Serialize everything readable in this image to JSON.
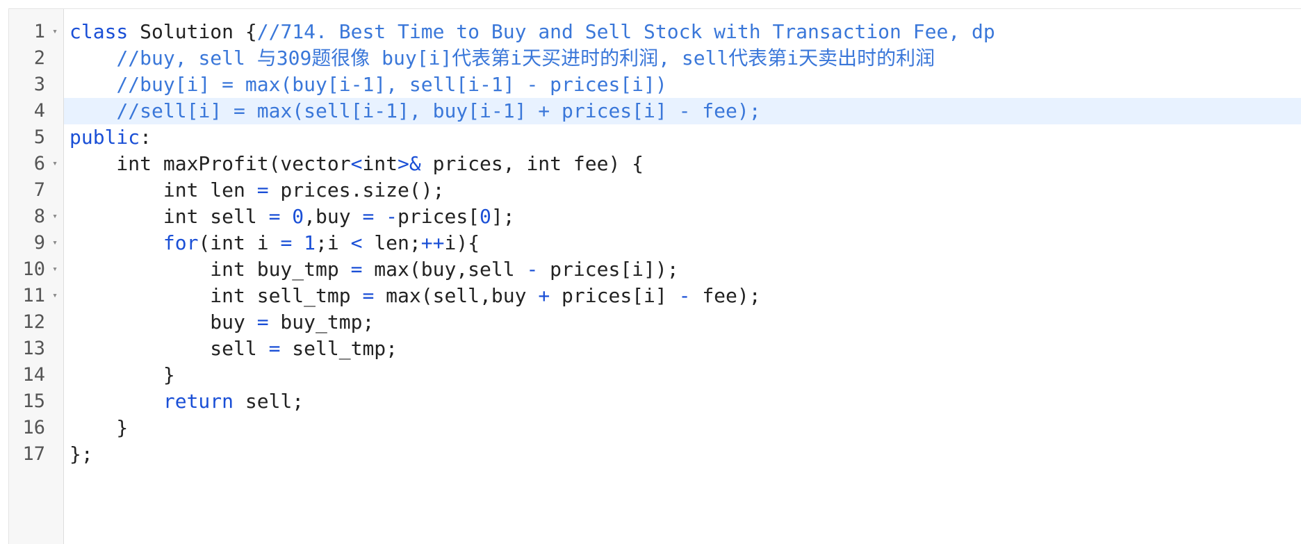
{
  "editor": {
    "active_line": 4,
    "colors": {
      "keyword": "#1a4fd6",
      "comment": "#3a77d9",
      "text": "#222222",
      "active_line_bg": "#e8f2ff",
      "gutter_bg": "#f7f7f7"
    },
    "fold_icon": "triangle-down-icon",
    "lines": [
      {
        "number": "1",
        "fold": "▾",
        "tokens": [
          {
            "t": "kw",
            "v": "class"
          },
          {
            "t": "tx",
            "v": " Solution {"
          },
          {
            "t": "cm",
            "v": "//714. Best Time to Buy and Sell Stock with Transaction Fee, dp"
          }
        ]
      },
      {
        "number": "2",
        "fold": "",
        "tokens": [
          {
            "t": "tx",
            "v": "    "
          },
          {
            "t": "cm",
            "v": "//buy, sell 与309题很像 buy[i]代表第i天买进时的利润, sell代表第i天卖出时的利润"
          }
        ]
      },
      {
        "number": "3",
        "fold": "",
        "tokens": [
          {
            "t": "tx",
            "v": "    "
          },
          {
            "t": "cm",
            "v": "//buy[i] = max(buy[i-1], sell[i-1] - prices[i])"
          }
        ]
      },
      {
        "number": "4",
        "fold": "",
        "tokens": [
          {
            "t": "tx",
            "v": "    "
          },
          {
            "t": "cm",
            "v": "//sell[i] = max(sell[i-1], buy[i-1] + prices[i] - fee);"
          }
        ]
      },
      {
        "number": "5",
        "fold": "",
        "tokens": [
          {
            "t": "kw",
            "v": "public"
          },
          {
            "t": "tx",
            "v": ":"
          }
        ]
      },
      {
        "number": "6",
        "fold": "▾",
        "tokens": [
          {
            "t": "tx",
            "v": "    int maxProfit(vector"
          },
          {
            "t": "op",
            "v": "<"
          },
          {
            "t": "tx",
            "v": "int"
          },
          {
            "t": "op",
            "v": ">&"
          },
          {
            "t": "tx",
            "v": " prices, int fee) {"
          }
        ]
      },
      {
        "number": "7",
        "fold": "",
        "tokens": [
          {
            "t": "tx",
            "v": "        int len "
          },
          {
            "t": "op",
            "v": "="
          },
          {
            "t": "tx",
            "v": " prices.size();"
          }
        ]
      },
      {
        "number": "8",
        "fold": "▾",
        "tokens": [
          {
            "t": "tx",
            "v": "        int sell "
          },
          {
            "t": "op",
            "v": "="
          },
          {
            "t": "tx",
            "v": " "
          },
          {
            "t": "num",
            "v": "0"
          },
          {
            "t": "tx",
            "v": ",buy "
          },
          {
            "t": "op",
            "v": "="
          },
          {
            "t": "tx",
            "v": " "
          },
          {
            "t": "op",
            "v": "-"
          },
          {
            "t": "tx",
            "v": "prices["
          },
          {
            "t": "num",
            "v": "0"
          },
          {
            "t": "tx",
            "v": "];"
          }
        ]
      },
      {
        "number": "9",
        "fold": "▾",
        "tokens": [
          {
            "t": "tx",
            "v": "        "
          },
          {
            "t": "kw",
            "v": "for"
          },
          {
            "t": "tx",
            "v": "(int i "
          },
          {
            "t": "op",
            "v": "="
          },
          {
            "t": "tx",
            "v": " "
          },
          {
            "t": "num",
            "v": "1"
          },
          {
            "t": "tx",
            "v": ";i "
          },
          {
            "t": "op",
            "v": "<"
          },
          {
            "t": "tx",
            "v": " len;"
          },
          {
            "t": "op",
            "v": "++"
          },
          {
            "t": "tx",
            "v": "i){"
          }
        ]
      },
      {
        "number": "10",
        "fold": "▾",
        "tokens": [
          {
            "t": "tx",
            "v": "            int buy_tmp "
          },
          {
            "t": "op",
            "v": "="
          },
          {
            "t": "tx",
            "v": " max(buy,sell "
          },
          {
            "t": "op",
            "v": "-"
          },
          {
            "t": "tx",
            "v": " prices[i]);"
          }
        ]
      },
      {
        "number": "11",
        "fold": "▾",
        "tokens": [
          {
            "t": "tx",
            "v": "            int sell_tmp "
          },
          {
            "t": "op",
            "v": "="
          },
          {
            "t": "tx",
            "v": " max(sell,buy "
          },
          {
            "t": "op",
            "v": "+"
          },
          {
            "t": "tx",
            "v": " prices[i] "
          },
          {
            "t": "op",
            "v": "-"
          },
          {
            "t": "tx",
            "v": " fee);"
          }
        ]
      },
      {
        "number": "12",
        "fold": "",
        "tokens": [
          {
            "t": "tx",
            "v": "            buy "
          },
          {
            "t": "op",
            "v": "="
          },
          {
            "t": "tx",
            "v": " buy_tmp;"
          }
        ]
      },
      {
        "number": "13",
        "fold": "",
        "tokens": [
          {
            "t": "tx",
            "v": "            sell "
          },
          {
            "t": "op",
            "v": "="
          },
          {
            "t": "tx",
            "v": " sell_tmp;"
          }
        ]
      },
      {
        "number": "14",
        "fold": "",
        "tokens": [
          {
            "t": "tx",
            "v": "        }"
          }
        ]
      },
      {
        "number": "15",
        "fold": "",
        "tokens": [
          {
            "t": "tx",
            "v": "        "
          },
          {
            "t": "kw",
            "v": "return"
          },
          {
            "t": "tx",
            "v": " sell;"
          }
        ]
      },
      {
        "number": "16",
        "fold": "",
        "tokens": [
          {
            "t": "tx",
            "v": "    }"
          }
        ]
      },
      {
        "number": "17",
        "fold": "",
        "tokens": [
          {
            "t": "tx",
            "v": "};"
          }
        ]
      }
    ]
  }
}
